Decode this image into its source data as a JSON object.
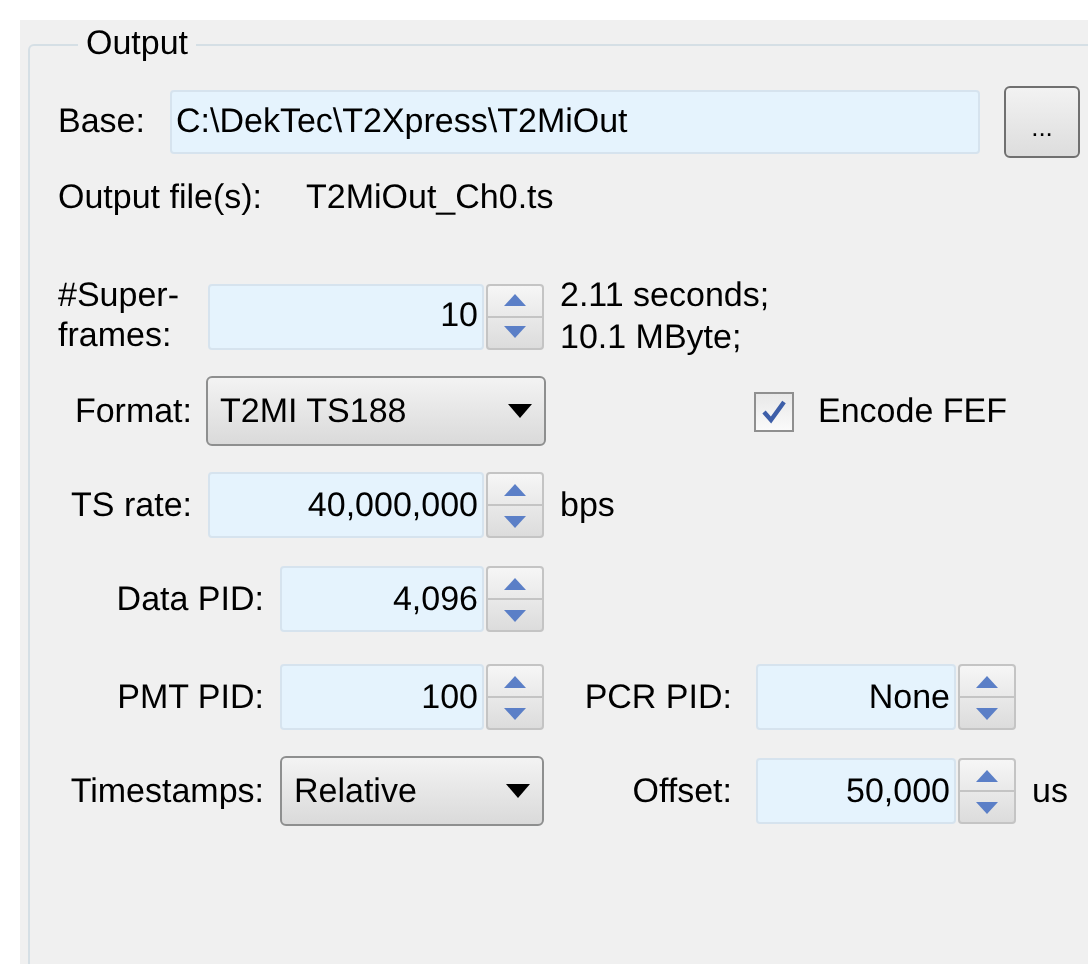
{
  "group": {
    "title": "Output"
  },
  "base": {
    "label": "Base:",
    "value": "C:\\DekTec\\T2Xpress\\T2MiOut",
    "browse_button": "..."
  },
  "output_files": {
    "label": "Output file(s):",
    "value": "T2MiOut_Ch0.ts"
  },
  "superframes": {
    "label": "#Super-frames:",
    "value": "10",
    "info": [
      "2.11 seconds;",
      "10.1 MByte;"
    ]
  },
  "format": {
    "label": "Format:",
    "value": "T2MI TS188"
  },
  "encode_fef": {
    "label": "Encode FEF",
    "checked": true
  },
  "ts_rate": {
    "label": "TS rate:",
    "value": "40,000,000",
    "unit": "bps"
  },
  "data_pid": {
    "label": "Data PID:",
    "value": "4,096"
  },
  "pmt_pid": {
    "label": "PMT PID:",
    "value": "100"
  },
  "pcr_pid": {
    "label": "PCR PID:",
    "value": "None"
  },
  "timestamps": {
    "label": "Timestamps:",
    "value": "Relative"
  },
  "offset": {
    "label": "Offset:",
    "value": "50,000",
    "unit": "us"
  }
}
